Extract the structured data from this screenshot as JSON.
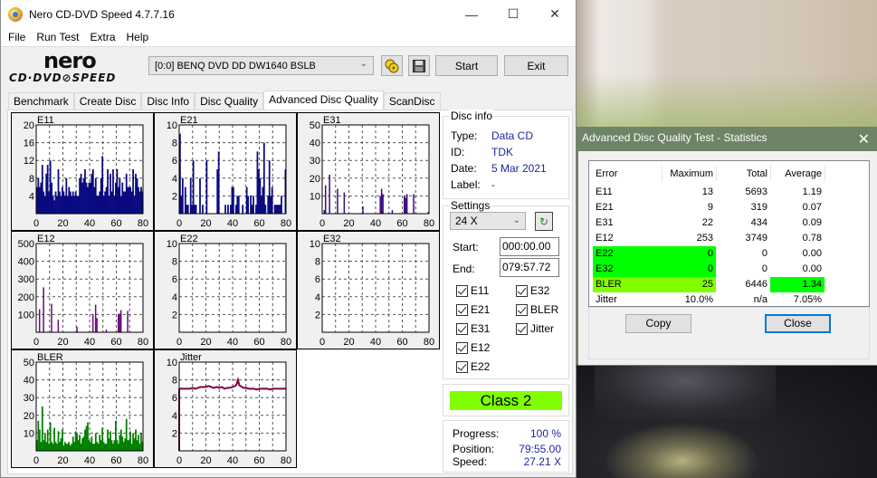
{
  "window": {
    "title": "Nero CD-DVD Speed 4.7.7.16",
    "minimize_glyph": "—",
    "maximize_glyph": "☐",
    "close_glyph": "✕"
  },
  "menu": [
    "File",
    "Run Test",
    "Extra",
    "Help"
  ],
  "logo": {
    "top": "nero",
    "bottom": "CD·DVD⊘SPEED"
  },
  "toolbar": {
    "drive": "[0:0]   BENQ DVD DD DW1640 BSLB",
    "start_label": "Start",
    "exit_label": "Exit"
  },
  "tabs": [
    "Benchmark",
    "Create Disc",
    "Disc Info",
    "Disc Quality",
    "Advanced Disc Quality",
    "ScanDisc"
  ],
  "active_tab": "Advanced Disc Quality",
  "disc_info": {
    "title": "Disc info",
    "type_label": "Type:",
    "type": "Data CD",
    "id_label": "ID:",
    "id": "TDK",
    "date_label": "Date:",
    "date": "5 Mar 2021",
    "label_label": "Label:",
    "label": "-"
  },
  "settings": {
    "title": "Settings",
    "speed": "24 X",
    "start_label": "Start:",
    "start": "000:00.00",
    "end_label": "End:",
    "end": "079:57.72",
    "checkboxes": [
      {
        "label": "E11",
        "checked": true
      },
      {
        "label": "E21",
        "checked": true
      },
      {
        "label": "E31",
        "checked": true
      },
      {
        "label": "E12",
        "checked": true
      },
      {
        "label": "E22",
        "checked": true
      },
      {
        "label": "E32",
        "checked": true
      },
      {
        "label": "BLER",
        "checked": true
      },
      {
        "label": "Jitter",
        "checked": true
      }
    ]
  },
  "class_result": {
    "text": "Class 2",
    "color": "#80ff00"
  },
  "progress": {
    "progress_label": "Progress:",
    "progress": "100 %",
    "position_label": "Position:",
    "position": "79:55.00",
    "speed_label": "Speed:",
    "speed": "27.21 X"
  },
  "stats_dialog": {
    "title": "Advanced Disc Quality Test - Statistics",
    "columns": [
      "Error",
      "Maximum",
      "Total",
      "Average"
    ],
    "rows": [
      {
        "error": "E11",
        "maximum": "13",
        "total": "5693",
        "average": "1.19",
        "max_highlight": "",
        "avg_highlight": ""
      },
      {
        "error": "E21",
        "maximum": "9",
        "total": "319",
        "average": "0.07",
        "max_highlight": "",
        "avg_highlight": ""
      },
      {
        "error": "E31",
        "maximum": "22",
        "total": "434",
        "average": "0.09",
        "max_highlight": "",
        "avg_highlight": ""
      },
      {
        "error": "E12",
        "maximum": "253",
        "total": "3749",
        "average": "0.78",
        "max_highlight": "",
        "avg_highlight": ""
      },
      {
        "error": "E22",
        "maximum": "0",
        "total": "0",
        "average": "0.00",
        "max_highlight": "#00ff00",
        "avg_highlight": ""
      },
      {
        "error": "E32",
        "maximum": "0",
        "total": "0",
        "average": "0.00",
        "max_highlight": "#00ff00",
        "avg_highlight": ""
      },
      {
        "error": "BLER",
        "maximum": "25",
        "total": "6446",
        "average": "1.34",
        "max_highlight": "#80ff00",
        "avg_highlight": "#00ff00"
      },
      {
        "error": "Jitter",
        "maximum": "10.0%",
        "total": "n/a",
        "average": "7.05%",
        "max_highlight": "",
        "avg_highlight": ""
      }
    ],
    "copy_label": "Copy",
    "close_label": "Close"
  },
  "chart_data": [
    {
      "type": "bar",
      "title": "E11",
      "xlim": [
        0,
        80
      ],
      "ylim": [
        0,
        20
      ],
      "xticks": [
        0,
        20,
        40,
        60,
        80
      ],
      "yticks": [
        4,
        8,
        12,
        16,
        20
      ],
      "color": "#0a0a80",
      "grid": true,
      "x": [
        0,
        1,
        2,
        3,
        4,
        5,
        6,
        7,
        8,
        9,
        10,
        11,
        12,
        13,
        14,
        15,
        16,
        17,
        18,
        19,
        20,
        21,
        22,
        23,
        24,
        25,
        26,
        27,
        28,
        29,
        30,
        31,
        32,
        33,
        34,
        35,
        36,
        37,
        38,
        39,
        40,
        41,
        42,
        43,
        44,
        45,
        46,
        47,
        48,
        49,
        50,
        51,
        52,
        53,
        54,
        55,
        56,
        57,
        58,
        59,
        60,
        61,
        62,
        63,
        64,
        65,
        66,
        67,
        68,
        69,
        70,
        71,
        72,
        73,
        74,
        75,
        76,
        77,
        78,
        79
      ],
      "values": [
        6,
        8,
        6,
        7,
        11,
        5,
        4,
        9,
        11,
        5,
        12,
        7,
        4,
        3,
        5,
        4,
        10,
        5,
        4,
        6,
        5,
        4,
        8,
        4,
        6,
        5,
        4,
        5,
        4,
        5,
        4,
        4,
        8,
        9,
        7,
        8,
        10,
        7,
        6,
        7,
        7,
        9,
        10,
        6,
        8,
        4,
        4,
        5,
        8,
        13,
        4,
        5,
        6,
        10,
        4,
        9,
        5,
        10,
        4,
        7,
        10,
        6,
        8,
        4,
        7,
        5,
        5,
        9,
        6,
        6,
        6,
        5,
        10,
        4,
        9,
        8,
        6,
        5,
        6,
        5
      ]
    },
    {
      "type": "bar",
      "title": "E21",
      "xlim": [
        0,
        80
      ],
      "ylim": [
        0,
        10
      ],
      "xticks": [
        0,
        20,
        40,
        60,
        80
      ],
      "yticks": [
        2,
        4,
        6,
        8,
        10
      ],
      "color": "#0a0a80",
      "grid": true,
      "x": [
        0,
        1,
        2,
        3,
        4,
        5,
        6,
        7,
        8,
        9,
        10,
        11,
        12,
        13,
        14,
        15,
        16,
        17,
        18,
        19,
        20,
        21,
        22,
        23,
        24,
        25,
        26,
        27,
        28,
        29,
        30,
        31,
        32,
        33,
        34,
        35,
        36,
        37,
        38,
        39,
        40,
        41,
        42,
        43,
        44,
        45,
        46,
        47,
        48,
        49,
        50,
        51,
        52,
        53,
        54,
        55,
        56,
        57,
        58,
        59,
        60,
        61,
        62,
        63,
        64,
        65,
        66,
        67,
        68,
        69,
        70,
        71,
        72,
        73,
        74,
        75,
        76,
        77,
        78,
        79
      ],
      "values": [
        9,
        2,
        4,
        0,
        3,
        1,
        1,
        0,
        4,
        1,
        6,
        1,
        1,
        0,
        0,
        4,
        0,
        1,
        0,
        0,
        6,
        0,
        0,
        0,
        0,
        0,
        0,
        0,
        5,
        7,
        0,
        0,
        0,
        0,
        1,
        0,
        1,
        0,
        1,
        3,
        3,
        0,
        1,
        2,
        2,
        0,
        0,
        1,
        0,
        0,
        3,
        2,
        0,
        2,
        1,
        2,
        0,
        1,
        7,
        5,
        4,
        2,
        3,
        8,
        1,
        0,
        2,
        6,
        2,
        3,
        0,
        1,
        1,
        1,
        1,
        1,
        2,
        0,
        0,
        5
      ]
    },
    {
      "type": "bar",
      "title": "E31",
      "xlim": [
        0,
        80
      ],
      "ylim": [
        0,
        50
      ],
      "xticks": [
        0,
        20,
        40,
        60,
        80
      ],
      "yticks": [
        10,
        20,
        30,
        40,
        50
      ],
      "color": "#3a0a80",
      "grid": true,
      "x": [
        1,
        2,
        5,
        11,
        16,
        30,
        43,
        44,
        45,
        52,
        61,
        62,
        63,
        68,
        79
      ],
      "values": [
        2,
        16,
        22,
        14,
        12,
        4,
        10,
        14,
        11,
        2,
        10,
        9,
        11,
        11,
        1
      ]
    },
    {
      "type": "bar",
      "title": "E12",
      "xlim": [
        0,
        80
      ],
      "ylim": [
        0,
        500
      ],
      "xticks": [
        0,
        20,
        40,
        60,
        80
      ],
      "yticks": [
        100,
        200,
        300,
        400,
        500
      ],
      "color": "#6a0a80",
      "grid": true,
      "x": [
        2,
        5,
        11,
        16,
        30,
        42,
        44,
        45,
        52,
        61,
        62,
        63,
        68
      ],
      "values": [
        130,
        253,
        160,
        70,
        30,
        100,
        155,
        80,
        15,
        100,
        105,
        125,
        120
      ]
    },
    {
      "type": "bar",
      "title": "E22",
      "xlim": [
        0,
        80
      ],
      "ylim": [
        0,
        10
      ],
      "xticks": [
        0,
        20,
        40,
        60,
        80
      ],
      "yticks": [
        2,
        4,
        6,
        8,
        10
      ],
      "color": "#0a0a80",
      "grid": true,
      "x": [],
      "values": []
    },
    {
      "type": "bar",
      "title": "E32",
      "xlim": [
        0,
        80
      ],
      "ylim": [
        0,
        10
      ],
      "xticks": [
        0,
        20,
        40,
        60,
        80
      ],
      "yticks": [
        2,
        4,
        6,
        8,
        10
      ],
      "color": "#0a0a80",
      "grid": true,
      "x": [],
      "values": []
    },
    {
      "type": "bar",
      "title": "BLER",
      "xlim": [
        0,
        80
      ],
      "ylim": [
        0,
        50
      ],
      "xticks": [
        0,
        20,
        40,
        60,
        80
      ],
      "yticks": [
        10,
        20,
        30,
        40,
        50
      ],
      "color": "#008000",
      "grid": true,
      "x": [
        0,
        1,
        2,
        3,
        4,
        5,
        6,
        7,
        8,
        9,
        10,
        11,
        12,
        13,
        14,
        15,
        16,
        17,
        18,
        19,
        20,
        21,
        22,
        23,
        24,
        25,
        26,
        27,
        28,
        29,
        30,
        31,
        32,
        33,
        34,
        35,
        36,
        37,
        38,
        39,
        40,
        41,
        42,
        43,
        44,
        45,
        46,
        47,
        48,
        49,
        50,
        51,
        52,
        53,
        54,
        55,
        56,
        57,
        58,
        59,
        60,
        61,
        62,
        63,
        64,
        65,
        66,
        67,
        68,
        69,
        70,
        71,
        72,
        73,
        74,
        75,
        76,
        77,
        78,
        79
      ],
      "values": [
        6,
        17,
        12,
        5,
        25,
        6,
        10,
        5,
        12,
        4,
        16,
        5,
        4,
        13,
        5,
        4,
        11,
        5,
        7,
        12,
        3,
        5,
        4,
        4,
        5,
        3,
        4,
        8,
        5,
        11,
        10,
        6,
        9,
        4,
        7,
        8,
        12,
        14,
        16,
        6,
        5,
        8,
        4,
        4,
        10,
        5,
        4,
        9,
        6,
        13,
        5,
        4,
        4,
        12,
        7,
        11,
        6,
        4,
        6,
        17,
        6,
        4,
        9,
        12,
        8,
        5,
        7,
        18,
        6,
        6,
        11,
        4,
        10,
        7,
        12,
        6,
        9,
        4,
        10,
        5
      ]
    },
    {
      "type": "line",
      "title": "Jitter",
      "xlim": [
        0,
        80
      ],
      "ylim": [
        0,
        10
      ],
      "xticks": [
        0,
        20,
        40,
        60,
        80
      ],
      "yticks": [
        2,
        4,
        6,
        8,
        10
      ],
      "color": "#800040",
      "grid": true,
      "x": [
        0,
        2,
        4,
        6,
        8,
        10,
        12,
        14,
        16,
        18,
        20,
        22,
        24,
        26,
        28,
        30,
        32,
        34,
        36,
        38,
        40,
        42,
        43,
        44,
        45,
        46,
        48,
        50,
        52,
        54,
        56,
        58,
        60,
        62,
        64,
        66,
        68,
        70,
        72,
        74,
        76,
        78,
        80
      ],
      "values": [
        7.0,
        7.0,
        7.0,
        7.0,
        7.0,
        7.1,
        7.0,
        7.1,
        7.2,
        7.2,
        7.2,
        7.3,
        7.2,
        7.1,
        7.2,
        7.1,
        7.2,
        7.0,
        7.1,
        7.1,
        7.2,
        7.3,
        7.5,
        8.0,
        7.4,
        7.3,
        7.1,
        7.1,
        7.0,
        7.0,
        7.0,
        6.9,
        7.0,
        7.0,
        7.0,
        7.0,
        6.9,
        7.0,
        7.0,
        7.0,
        7.0,
        7.0,
        7.0
      ]
    }
  ]
}
